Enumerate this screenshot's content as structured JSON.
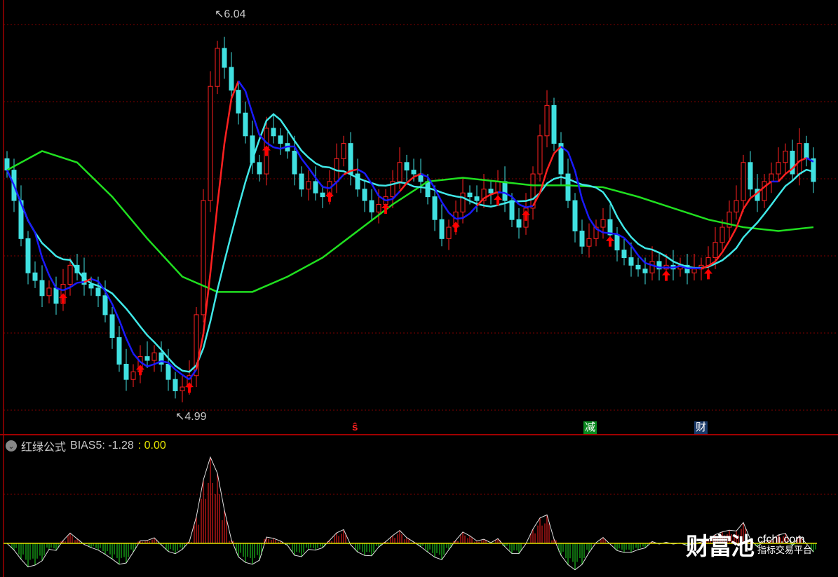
{
  "chart_data": {
    "type": "candlestick",
    "ylim": [
      4.944,
      6.077
    ],
    "high_label": "6.04",
    "low_label": "4.99",
    "closes": [
      5.63,
      5.55,
      5.45,
      5.36,
      5.34,
      5.3,
      5.32,
      5.28,
      5.33,
      5.38,
      5.36,
      5.33,
      5.32,
      5.3,
      5.25,
      5.19,
      5.12,
      5.08,
      5.1,
      5.14,
      5.13,
      5.15,
      5.12,
      5.08,
      5.05,
      5.06,
      5.09,
      5.25,
      5.55,
      5.85,
      5.95,
      5.9,
      5.84,
      5.78,
      5.72,
      5.65,
      5.62,
      5.74,
      5.72,
      5.7,
      5.68,
      5.62,
      5.58,
      5.6,
      5.57,
      5.56,
      5.6,
      5.66,
      5.7,
      5.62,
      5.58,
      5.55,
      5.52,
      5.54,
      5.56,
      5.6,
      5.65,
      5.63,
      5.62,
      5.6,
      5.56,
      5.5,
      5.45,
      5.48,
      5.52,
      5.57,
      5.56,
      5.55,
      5.58,
      5.57,
      5.6,
      5.55,
      5.5,
      5.48,
      5.53,
      5.62,
      5.72,
      5.8,
      5.7,
      5.62,
      5.55,
      5.47,
      5.43,
      5.45,
      5.48,
      5.5,
      5.46,
      5.42,
      5.4,
      5.38,
      5.37,
      5.36,
      5.39,
      5.37,
      5.38,
      5.37,
      5.38,
      5.36,
      5.37,
      5.38,
      5.4,
      5.44,
      5.48,
      5.52,
      5.55,
      5.65,
      5.58,
      5.55,
      5.6,
      5.62,
      5.65,
      5.68,
      5.62,
      5.7,
      5.66,
      5.6
    ],
    "long_ma_samples": [
      5.63,
      5.68,
      5.65,
      5.56,
      5.45,
      5.35,
      5.31,
      5.31,
      5.35,
      5.4,
      5.47,
      5.54,
      5.6,
      5.61,
      5.6,
      5.59,
      5.59,
      5.585,
      5.56,
      5.53,
      5.5,
      5.48,
      5.47,
      5.48
    ],
    "buy_signal_indices": [
      8,
      19,
      26,
      37,
      46,
      54,
      64,
      70,
      74,
      86,
      94,
      100
    ],
    "colors": {
      "up": "#ff2020",
      "down": "#40e0e0",
      "ma_short": "#1a1aff",
      "ma_mid": "#40e8e8",
      "ma_long": "#20e020",
      "signal": "#ff0000",
      "zero_line": "#e6e600"
    }
  },
  "markers": [
    {
      "text": "ŝ",
      "color": "#ff2020",
      "bg": "transparent"
    },
    {
      "text": "减",
      "color": "#ffffff",
      "bg": "#0a8a20"
    },
    {
      "text": "财",
      "color": "#ffffff",
      "bg": "#1a3a6a"
    }
  ],
  "indicator": {
    "name": "红绿公式",
    "bias_label": "BIAS5: -1.28",
    "value": ": 0.00",
    "collapse_icon": "chevron-down-icon"
  },
  "watermark": {
    "brand": "财富池",
    "domain": "cfchi.com",
    "slogan": "指标交易平台"
  }
}
